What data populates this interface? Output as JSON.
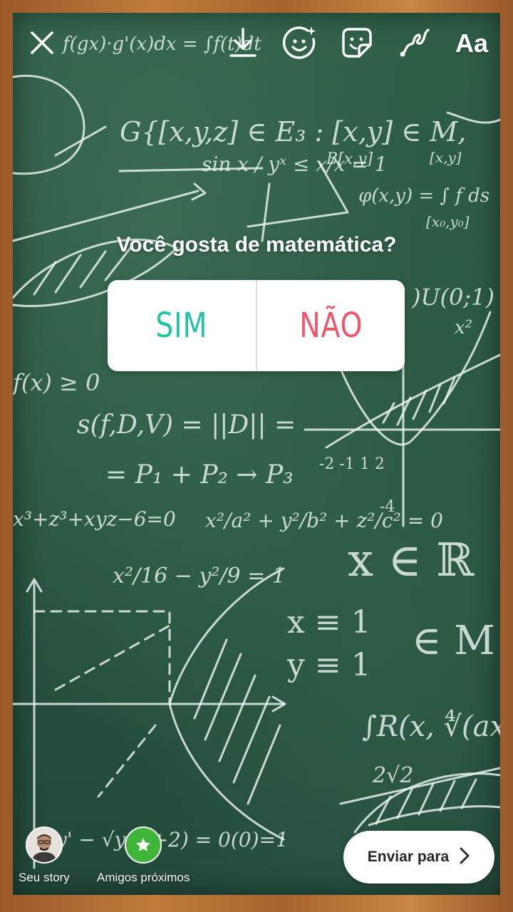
{
  "toolbar": {
    "close_icon": "close-icon",
    "download_icon": "download-icon",
    "effects_icon": "face-effects-icon",
    "sticker_icon": "sticker-icon",
    "draw_icon": "draw-icon",
    "text_tool_label": "Aa"
  },
  "poll": {
    "question": "Você gosta de matemática?",
    "option_yes": "SIM",
    "option_no": "NÃO",
    "colors": {
      "yes": "#21c3a4",
      "no": "#f0566a"
    }
  },
  "share": {
    "your_story_label": "Seu story",
    "close_friends_label": "Amigos próximos",
    "close_friends_color": "#3fb53a",
    "send_label": "Enviar para",
    "send_icon": "chevron-right-icon"
  },
  "background": {
    "board_color": "#2a5842",
    "frame_color": "#b06c32",
    "chalk_text": {
      "t1": "f(gx)·g'(x)dx = ∫f(t)dt",
      "t2": "G{[x,y,z] ∈ E₃ : [x,y] ∈ M,",
      "t3": "sin x / yˣ ≤ x/x = 1",
      "t4": "B[x,y]",
      "t5": "φ(x,y) = ∫ f ds",
      "t6": "[x,y]",
      "t7": "[x₀,y₀]",
      "t8": ")U(0;1)",
      "t9": "f(x) ≥ 0",
      "t10": "s(f,D,V) = ||D|| =",
      "t11": "= P₁ + P₂ → P₃",
      "t12": "x³+z³+xyz−6=0",
      "t13": "x²/a² + y²/b² + z²/c² = 0",
      "t14": "x ∈ ℝ",
      "t15": "x²/16 − y²/9 = 1",
      "t16": "x ≡ 1",
      "t17": "y ≡ 1",
      "t18": "∈ M",
      "t19": "∫R(x, ∜(ax/cx))",
      "t20": "2√2",
      "t21": "y' − √y/(x+2) = 0(0)=1",
      "t22": "-2 -1 1 2",
      "t23": "-4",
      "t24": "x²"
    }
  }
}
